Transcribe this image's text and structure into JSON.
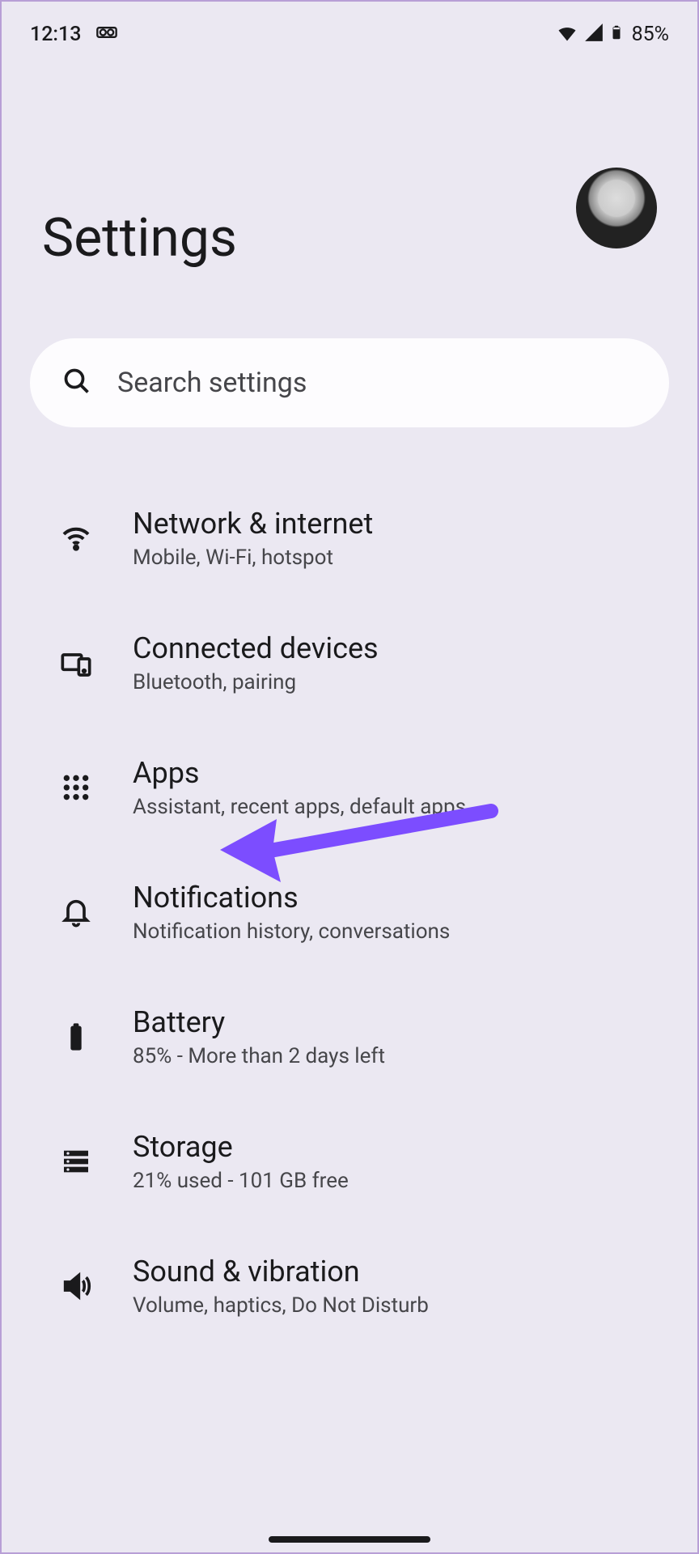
{
  "status": {
    "time": "12:13",
    "battery_text": "85%"
  },
  "header": {
    "title": "Settings"
  },
  "search": {
    "placeholder": "Search settings"
  },
  "items": [
    {
      "title": "Network & internet",
      "subtitle": "Mobile, Wi-Fi, hotspot"
    },
    {
      "title": "Connected devices",
      "subtitle": "Bluetooth, pairing"
    },
    {
      "title": "Apps",
      "subtitle": "Assistant, recent apps, default apps"
    },
    {
      "title": "Notifications",
      "subtitle": "Notification history, conversations"
    },
    {
      "title": "Battery",
      "subtitle": "85% - More than 2 days left"
    },
    {
      "title": "Storage",
      "subtitle": "21% used - 101 GB free"
    },
    {
      "title": "Sound & vibration",
      "subtitle": "Volume, haptics, Do Not Disturb"
    }
  ]
}
